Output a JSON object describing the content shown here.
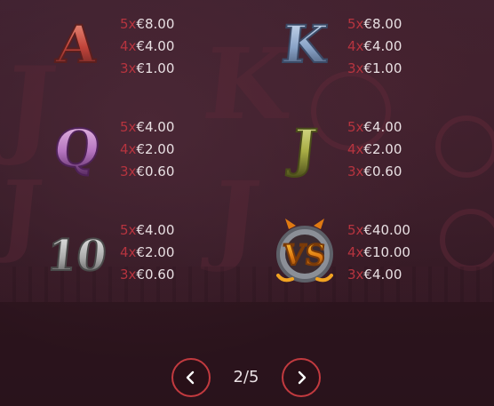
{
  "paytable": {
    "symbols": [
      {
        "name": "A",
        "glyph": "A",
        "colors": [
          "#f3a08a",
          "#c1443a",
          "#5a1f1f"
        ],
        "payouts": [
          {
            "mult": "5x",
            "amount": "€8.00"
          },
          {
            "mult": "4x",
            "amount": "€4.00"
          },
          {
            "mult": "3x",
            "amount": "€1.00"
          }
        ]
      },
      {
        "name": "K",
        "glyph": "K",
        "colors": [
          "#d9e6f7",
          "#8aa4c8",
          "#3b4a66"
        ],
        "payouts": [
          {
            "mult": "5x",
            "amount": "€8.00"
          },
          {
            "mult": "4x",
            "amount": "€4.00"
          },
          {
            "mult": "3x",
            "amount": "€1.00"
          }
        ]
      },
      {
        "name": "Q",
        "glyph": "Q",
        "colors": [
          "#f0c8ea",
          "#b575c0",
          "#4f2257"
        ],
        "payouts": [
          {
            "mult": "5x",
            "amount": "€4.00"
          },
          {
            "mult": "4x",
            "amount": "€2.00"
          },
          {
            "mult": "3x",
            "amount": "€0.60"
          }
        ]
      },
      {
        "name": "J",
        "glyph": "J",
        "colors": [
          "#e3e89c",
          "#a8ad45",
          "#4a4c1a"
        ],
        "payouts": [
          {
            "mult": "5x",
            "amount": "€4.00"
          },
          {
            "mult": "4x",
            "amount": "€2.00"
          },
          {
            "mult": "3x",
            "amount": "€0.60"
          }
        ]
      },
      {
        "name": "10",
        "glyph": "10",
        "colors": [
          "#eeeeee",
          "#a9a9a9",
          "#4a4a4a"
        ],
        "payouts": [
          {
            "mult": "5x",
            "amount": "€4.00"
          },
          {
            "mult": "4x",
            "amount": "€2.00"
          },
          {
            "mult": "3x",
            "amount": "€0.60"
          }
        ]
      },
      {
        "name": "VS",
        "glyph": "VS",
        "colors": [
          "#ffcf3a",
          "#e07a12",
          "#7a3a08"
        ],
        "payouts": [
          {
            "mult": "5x",
            "amount": "€40.00"
          },
          {
            "mult": "4x",
            "amount": "€10.00"
          },
          {
            "mult": "3x",
            "amount": "€4.00"
          }
        ]
      }
    ]
  },
  "pagination": {
    "current": "2/5",
    "prev_icon": "chevron-left-icon",
    "next_icon": "chevron-right-icon",
    "accent": "#c23a3f"
  }
}
